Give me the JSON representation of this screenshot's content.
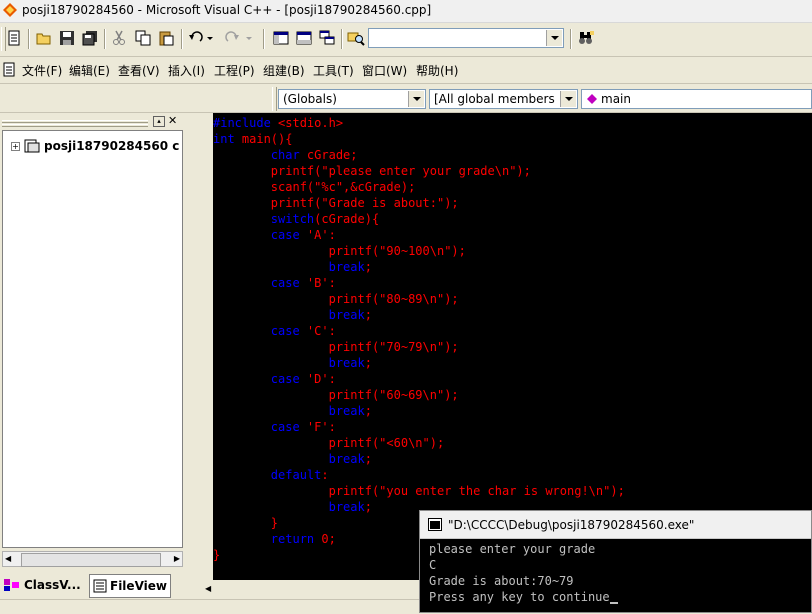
{
  "window": {
    "title": "posji18790284560 - Microsoft Visual C++ - [posji18790284560.cpp]"
  },
  "toolbar": {
    "find_value": ""
  },
  "menu": {
    "items": [
      {
        "label": "文件(F)"
      },
      {
        "label": "编辑(E)"
      },
      {
        "label": "查看(V)"
      },
      {
        "label": "插入(I)"
      },
      {
        "label": "工程(P)"
      },
      {
        "label": "组建(B)"
      },
      {
        "label": "工具(T)"
      },
      {
        "label": "窗口(W)"
      },
      {
        "label": "帮助(H)"
      }
    ]
  },
  "wizard": {
    "scope": "(Globals)",
    "members": "[All global members",
    "function": "main"
  },
  "workspace": {
    "tree_root": "posji18790284560 c",
    "tabs": [
      {
        "label": "ClassV..."
      },
      {
        "label": "FileView"
      }
    ]
  },
  "editor": {
    "lines": [
      [
        {
          "t": "#include ",
          "c": "kw"
        },
        {
          "t": "<stdio.h>",
          "c": "tx"
        }
      ],
      [
        {
          "t": "int ",
          "c": "kw"
        },
        {
          "t": "main(){",
          "c": "tx"
        }
      ],
      [
        {
          "t": "        "
        },
        {
          "t": "char ",
          "c": "kw"
        },
        {
          "t": "cGrade;",
          "c": "tx"
        }
      ],
      [
        {
          "t": "        "
        },
        {
          "t": "printf(\"please enter your grade\\n\");",
          "c": "tx"
        }
      ],
      [
        {
          "t": "        "
        },
        {
          "t": "scanf(\"%c\",&cGrade);",
          "c": "tx"
        }
      ],
      [
        {
          "t": "        "
        },
        {
          "t": "printf(\"Grade is about:\");",
          "c": "tx"
        }
      ],
      [
        {
          "t": "        "
        },
        {
          "t": "switch",
          "c": "kw"
        },
        {
          "t": "(cGrade){",
          "c": "tx"
        }
      ],
      [
        {
          "t": "        "
        },
        {
          "t": "case ",
          "c": "kw"
        },
        {
          "t": "'A':",
          "c": "tx"
        }
      ],
      [
        {
          "t": "                "
        },
        {
          "t": "printf(\"90~100\\n\");",
          "c": "tx"
        }
      ],
      [
        {
          "t": "                "
        },
        {
          "t": "break",
          "c": "kw"
        },
        {
          "t": ";",
          "c": "tx"
        }
      ],
      [
        {
          "t": "        "
        },
        {
          "t": "case ",
          "c": "kw"
        },
        {
          "t": "'B':",
          "c": "tx"
        }
      ],
      [
        {
          "t": "                "
        },
        {
          "t": "printf(\"80~89\\n\");",
          "c": "tx"
        }
      ],
      [
        {
          "t": "                "
        },
        {
          "t": "break",
          "c": "kw"
        },
        {
          "t": ";",
          "c": "tx"
        }
      ],
      [
        {
          "t": "        "
        },
        {
          "t": "case ",
          "c": "kw"
        },
        {
          "t": "'C':",
          "c": "tx"
        }
      ],
      [
        {
          "t": "                "
        },
        {
          "t": "printf(\"70~79\\n\");",
          "c": "tx"
        }
      ],
      [
        {
          "t": "                "
        },
        {
          "t": "break",
          "c": "kw"
        },
        {
          "t": ";",
          "c": "tx"
        }
      ],
      [
        {
          "t": "        "
        },
        {
          "t": "case ",
          "c": "kw"
        },
        {
          "t": "'D':",
          "c": "tx"
        }
      ],
      [
        {
          "t": "                "
        },
        {
          "t": "printf(\"60~69\\n\");",
          "c": "tx"
        }
      ],
      [
        {
          "t": "                "
        },
        {
          "t": "break",
          "c": "kw"
        },
        {
          "t": ";",
          "c": "tx"
        }
      ],
      [
        {
          "t": "        "
        },
        {
          "t": "case ",
          "c": "kw"
        },
        {
          "t": "'F':",
          "c": "tx"
        }
      ],
      [
        {
          "t": "                "
        },
        {
          "t": "printf(\"<60\\n\");",
          "c": "tx"
        }
      ],
      [
        {
          "t": "                "
        },
        {
          "t": "break",
          "c": "kw"
        },
        {
          "t": ";",
          "c": "tx"
        }
      ],
      [
        {
          "t": "        "
        },
        {
          "t": "default",
          "c": "kw"
        },
        {
          "t": ":",
          "c": "tx"
        }
      ],
      [
        {
          "t": "                "
        },
        {
          "t": "printf(\"you enter the char is wrong!\\n\");",
          "c": "tx"
        }
      ],
      [
        {
          "t": "                "
        },
        {
          "t": "break",
          "c": "kw"
        },
        {
          "t": ";",
          "c": "tx"
        }
      ],
      [
        {
          "t": "        "
        },
        {
          "t": "}",
          "c": "tx"
        }
      ],
      [
        {
          "t": "        "
        },
        {
          "t": "return ",
          "c": "kw"
        },
        {
          "t": "0;",
          "c": "tx"
        }
      ],
      [
        {
          "t": "}",
          "c": "tx"
        }
      ]
    ]
  },
  "console": {
    "title": "\"D:\\CCCC\\Debug\\posji18790284560.exe\"",
    "lines": [
      "please enter your grade",
      "C",
      "Grade is about:70~79",
      "Press any key to continue"
    ]
  },
  "colors": {
    "keyword": "#0000ff",
    "text": "#ff0000",
    "editor_bg": "#000000"
  }
}
